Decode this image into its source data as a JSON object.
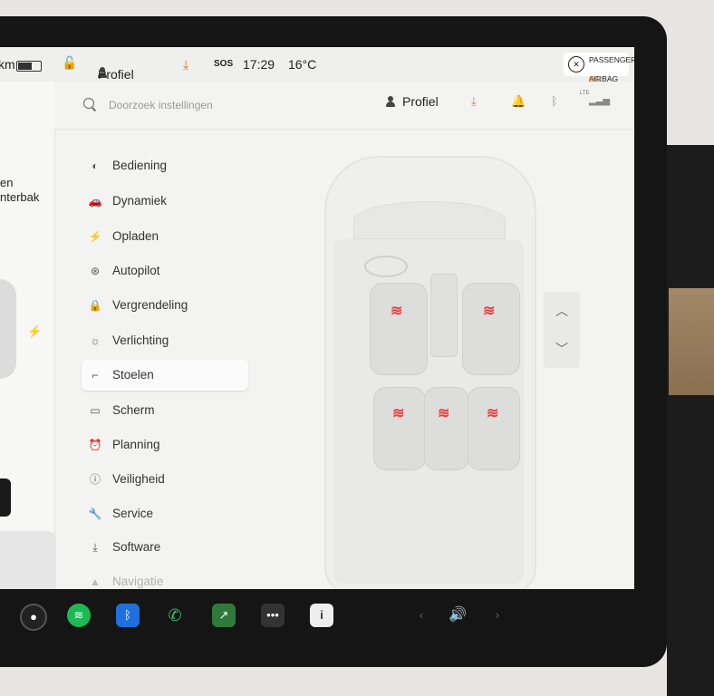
{
  "status_bar": {
    "range_fragment": "km",
    "profile_label": "Profiel",
    "sos_label": "SOS",
    "time": "17:29",
    "temperature": "16°C",
    "airbag": {
      "line1": "PASSENGER",
      "line2_prefix": "AIRBAG ",
      "line2_state": "ON"
    }
  },
  "left_panel": {
    "text_line1": "en",
    "text_line2": "nterbak"
  },
  "header": {
    "search_placeholder": "Doorzoek instellingen",
    "profile_label": "Profiel",
    "lte_label": "LTE"
  },
  "nav": {
    "items": [
      {
        "label": "Bediening",
        "icon": "toggle-icon"
      },
      {
        "label": "Dynamiek",
        "icon": "car-icon"
      },
      {
        "label": "Opladen",
        "icon": "bolt-icon"
      },
      {
        "label": "Autopilot",
        "icon": "steering-wheel-icon"
      },
      {
        "label": "Vergrendeling",
        "icon": "lock-icon"
      },
      {
        "label": "Verlichting",
        "icon": "light-icon"
      },
      {
        "label": "Stoelen",
        "icon": "seat-icon",
        "active": true
      },
      {
        "label": "Scherm",
        "icon": "display-icon"
      },
      {
        "label": "Planning",
        "icon": "alarm-clock-icon"
      },
      {
        "label": "Veiligheid",
        "icon": "alert-icon"
      },
      {
        "label": "Service",
        "icon": "wrench-icon"
      },
      {
        "label": "Software",
        "icon": "download-icon"
      },
      {
        "label": "Navigatie",
        "icon": "navigation-icon"
      }
    ]
  },
  "seats": {
    "heaters_on": [
      "driver",
      "passenger",
      "rear-left",
      "rear-center",
      "rear-right"
    ],
    "heater_color": "#e8403a"
  },
  "accent_color": "#e07b20"
}
